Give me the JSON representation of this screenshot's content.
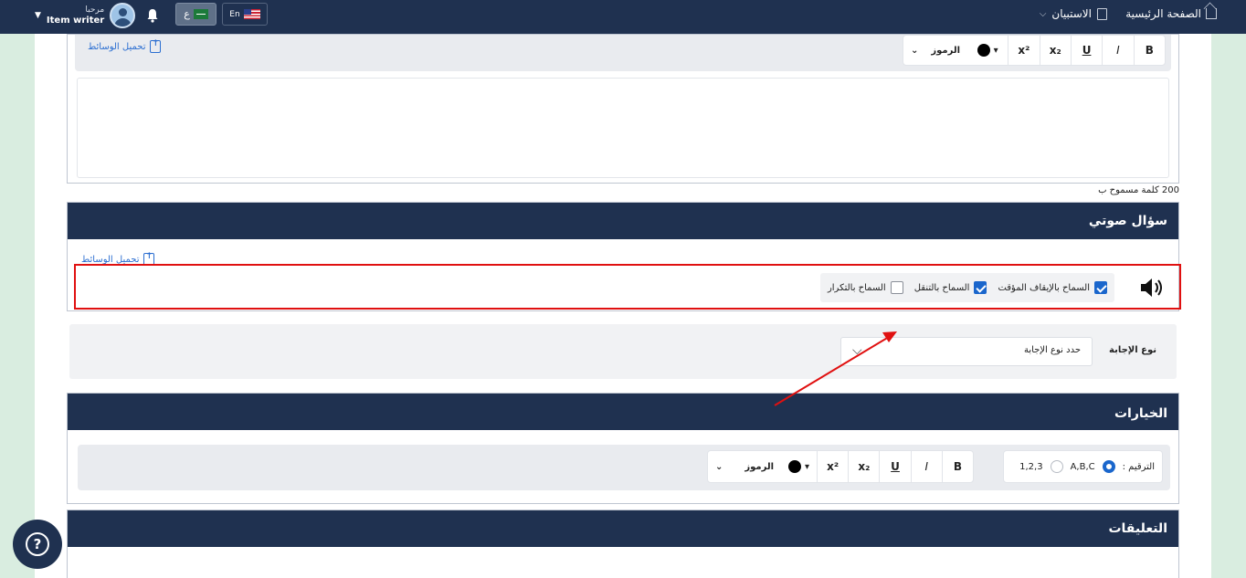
{
  "topbar": {
    "user_greeting": "مرحبا",
    "user_role": "Item writer",
    "lang_ar": "ع",
    "lang_en": "En",
    "nav_home": "الصفحة الرئيسية",
    "nav_bank": "الاستبيان"
  },
  "editor": {
    "bold": "B",
    "italic": "I",
    "underline": "U",
    "subscript": "x₂",
    "superscript": "x²",
    "color_caret": "▾",
    "symbols_label": "الرموز",
    "symbols_caret": "⌄",
    "upload_media": "تحميل الوسائط"
  },
  "word_limit": "200 كلمة مسموح ب",
  "audio_question": {
    "title": "سؤال صوتي",
    "upload_media": "تحميل الوسائط",
    "options": [
      {
        "label": "السماح بالإيقاف المؤقت",
        "checked": true
      },
      {
        "label": "السماح بالتنقل",
        "checked": true
      },
      {
        "label": "السماح بالتكرار",
        "checked": false
      }
    ]
  },
  "answer_type": {
    "label": "نوع الإجابة",
    "placeholder": "حدد نوع الإجابة",
    "chevron": "⌵"
  },
  "choices": {
    "title": "الخيارات",
    "numbering_label": "الترقيم :",
    "option_abc": "A,B,C",
    "option_123": "1,2,3",
    "selected": "A,B,C"
  },
  "comments": {
    "title": "التعليقات"
  },
  "help": {
    "label": "?"
  },
  "colors": {
    "navy": "#1f3150",
    "accent_blue": "#1a66cc",
    "annotation_red": "#e01010",
    "background_green": "#d9ede0"
  }
}
